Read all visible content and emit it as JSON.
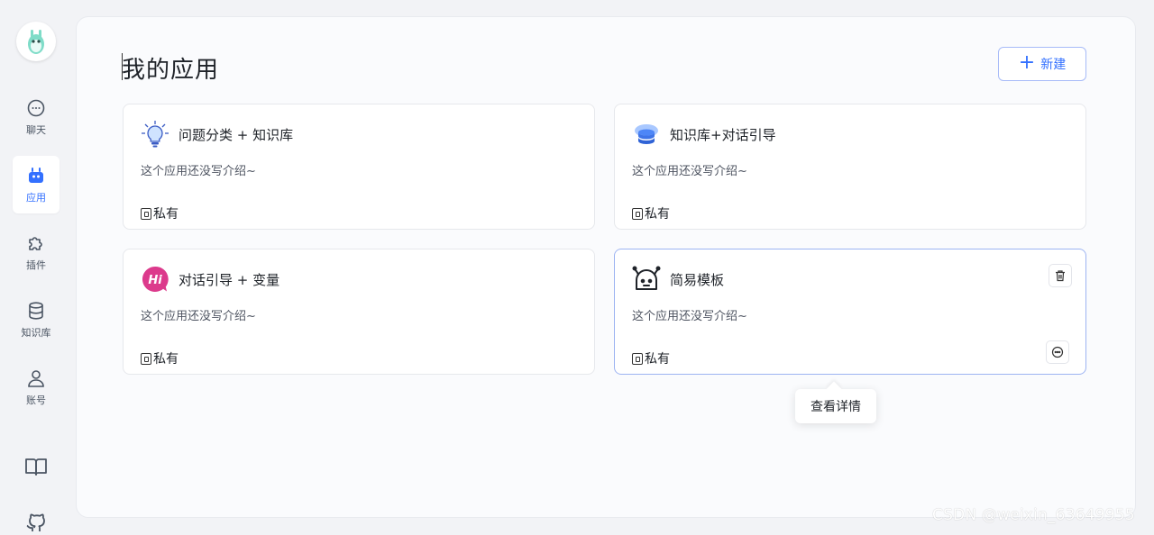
{
  "sidebar": {
    "logo_icon": "robot-avatar-icon",
    "items": [
      {
        "label": "聊天",
        "icon": "chat-icon",
        "active": false
      },
      {
        "label": "应用",
        "icon": "robot-icon",
        "active": true
      },
      {
        "label": "插件",
        "icon": "puzzle-icon",
        "active": false
      },
      {
        "label": "知识库",
        "icon": "database-icon",
        "active": false
      },
      {
        "label": "账号",
        "icon": "user-icon",
        "active": false
      }
    ],
    "bottom_icons": [
      "book-icon",
      "github-icon"
    ]
  },
  "main": {
    "title": "我的应用",
    "new_button": {
      "icon": "plus-icon",
      "label": "新建"
    }
  },
  "apps": [
    {
      "name": "问题分类 + 知识库",
      "desc": "这个应用还没写介绍~",
      "permission": "私有",
      "icon": "lightbulb-icon"
    },
    {
      "name": "知识库+对话引导",
      "desc": "这个应用还没写介绍~",
      "permission": "私有",
      "icon": "database-stack-icon"
    },
    {
      "name": "对话引导 + 变量",
      "desc": "这个应用还没写介绍~",
      "permission": "私有",
      "icon": "hi-bubble-icon"
    },
    {
      "name": "简易模板",
      "desc": "这个应用还没写介绍~",
      "permission": "私有",
      "icon": "robot-face-icon"
    }
  ],
  "tooltip": {
    "text": "查看详情"
  },
  "watermark": "CSDN @weixin_63649955",
  "colors": {
    "accent": "#3370ff",
    "card_active_border": "#9db4f2"
  }
}
